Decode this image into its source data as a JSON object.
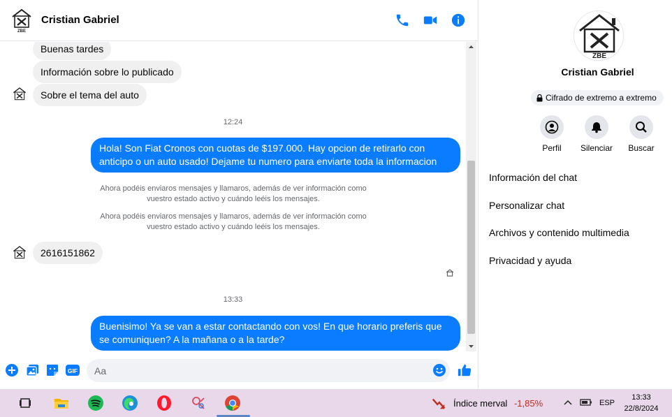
{
  "chat": {
    "contact_name": "Cristian Gabriel",
    "icons": {
      "call": "phone-icon",
      "video": "video-camera-icon",
      "info": "info-icon"
    },
    "messages": [
      {
        "dir": "in",
        "text": "Buenas tardes"
      },
      {
        "dir": "in",
        "text": "Información sobre lo publicado"
      },
      {
        "dir": "in",
        "text": "Sobre el tema del auto"
      },
      {
        "type": "time",
        "text": "12:24"
      },
      {
        "dir": "out",
        "text": "Hola! Son Fiat Cronos con cuotas de $197.000. Hay opcion de retirarlo con anticipo o un auto usado! Dejame tu numero para enviarte toda la informacion"
      },
      {
        "type": "system",
        "text": "Ahora podéis enviaros mensajes y llamaros, además de ver información como vuestro estado activo y cuándo leéis los mensajes."
      },
      {
        "type": "system",
        "text": "Ahora podéis enviaros mensajes y llamaros, además de ver información como vuestro estado activo y cuándo leéis los mensajes."
      },
      {
        "dir": "in",
        "text": "2616151862"
      },
      {
        "type": "time",
        "text": "13:33"
      },
      {
        "dir": "out",
        "text": "Buenisimo! Ya se van a estar contactando con vos! En que horario preferis que se comuniquen? A la mañana o a la tarde?"
      }
    ],
    "composer": {
      "placeholder": "Aa",
      "icons": [
        "plus-circle-icon",
        "photo-icon",
        "sticker-icon",
        "gif-icon",
        "emoji-icon",
        "thumbs-up-icon"
      ],
      "gif_label": "GIF"
    },
    "accent": "#0a7cff"
  },
  "logo_text": "ZBE",
  "info_panel": {
    "name": "Cristian Gabriel",
    "encryption_label": "Cifrado de extremo a extremo",
    "actions": [
      {
        "label": "Perfil",
        "icon": "profile-icon"
      },
      {
        "label": "Silenciar",
        "icon": "bell-icon"
      },
      {
        "label": "Buscar",
        "icon": "search-icon"
      }
    ],
    "menu": [
      "Información del chat",
      "Personalizar chat",
      "Archivos y contenido multimedia",
      "Privacidad y ayuda"
    ]
  },
  "taskbar": {
    "apps": [
      "task-view-icon",
      "file-explorer-icon",
      "spotify-icon",
      "edge-icon",
      "opera-icon",
      "app-icon",
      "chrome-icon"
    ],
    "market_label": "Índice merval",
    "market_change": "-1,85%",
    "language": "ESP",
    "time": "13:33",
    "date": "22/8/2024"
  }
}
